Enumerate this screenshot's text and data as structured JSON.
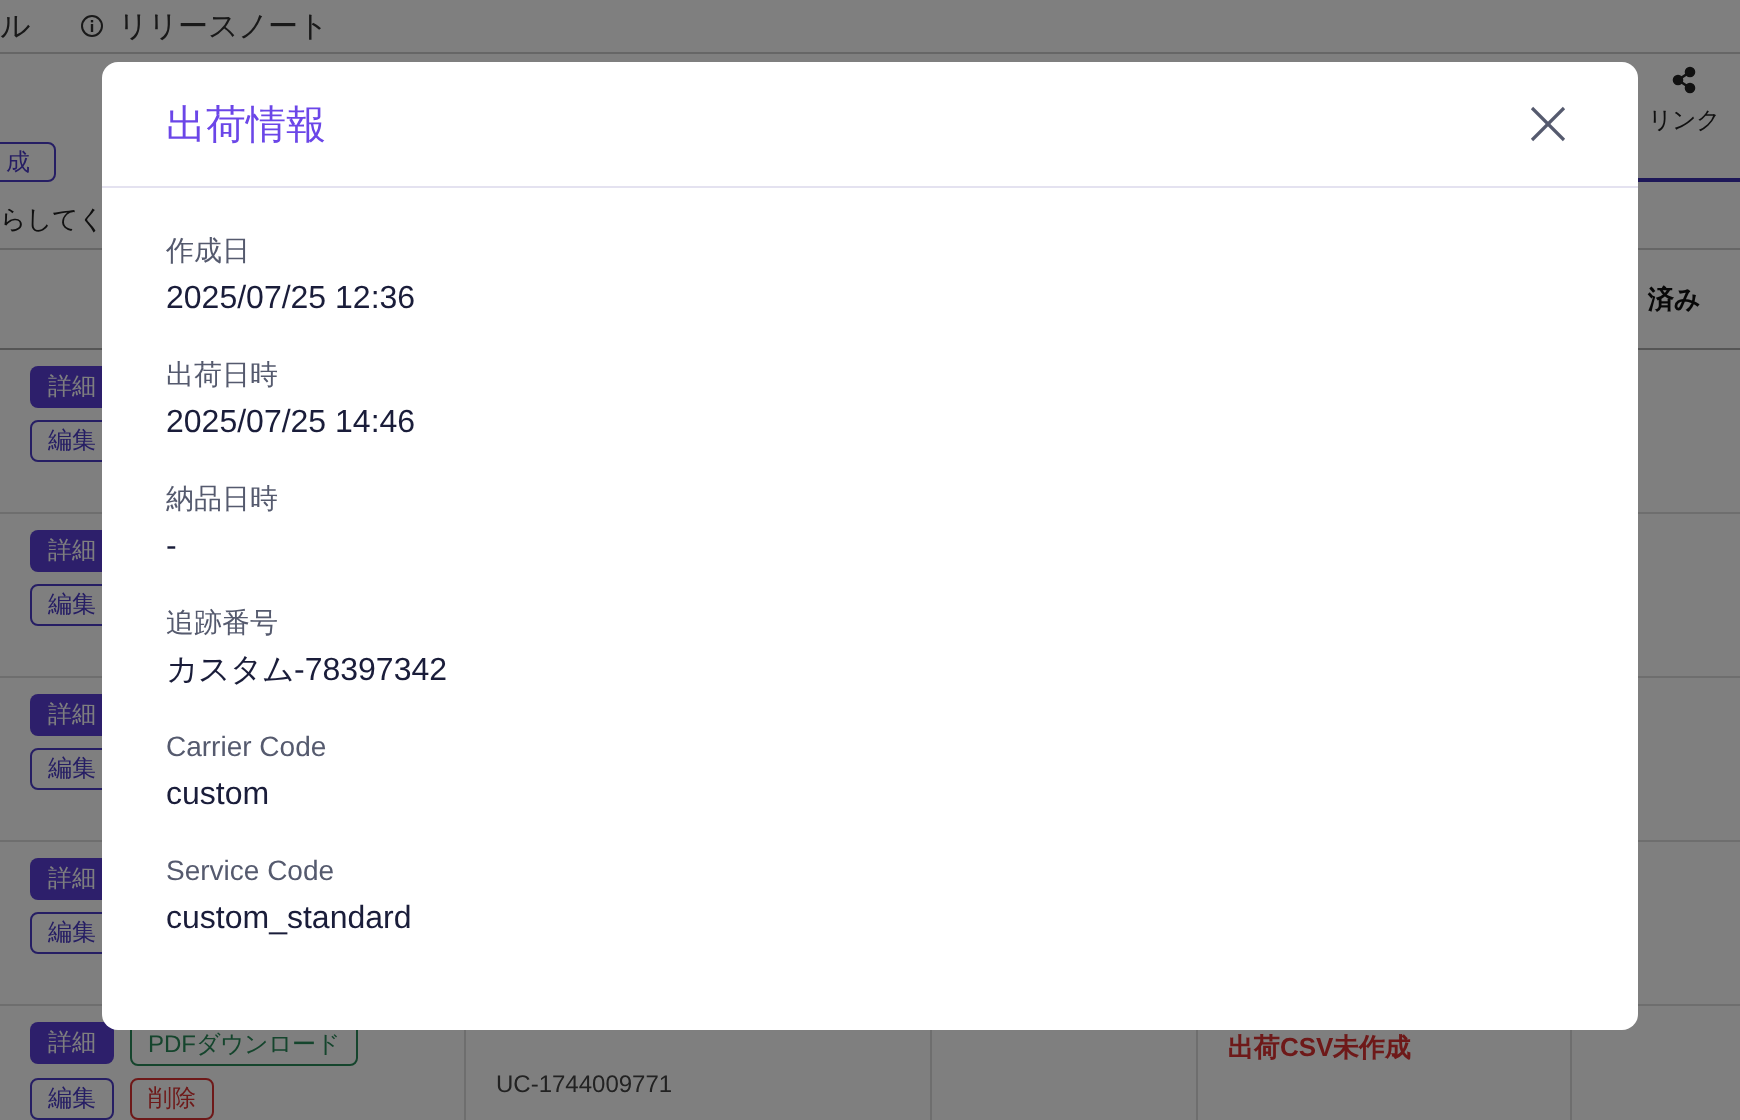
{
  "background": {
    "nav": {
      "cut_item": "ル",
      "release_notes": "リリースノート"
    },
    "toolbar": {
      "create_button": "成",
      "link": "リンク"
    },
    "notice": "らしてく",
    "header_status": "済み",
    "rows": [
      {
        "detail_button": "詳細",
        "edit_button": "編集"
      },
      {
        "detail_button": "詳細",
        "edit_button": "編集"
      },
      {
        "detail_button": "詳細",
        "edit_button": "編集"
      },
      {
        "detail_button": "詳細",
        "edit_button": "編集"
      },
      {
        "detail_button": "詳細",
        "edit_button": "編集",
        "pdf_button": "PDFダウンロード",
        "delete_button": "削除",
        "code": "UC-1744009771",
        "status": "出荷CSV未作成"
      }
    ]
  },
  "modal": {
    "title": "出荷情報",
    "fields": [
      {
        "label": "作成日",
        "value": "2025/07/25 12:36"
      },
      {
        "label": "出荷日時",
        "value": "2025/07/25 14:46"
      },
      {
        "label": "納品日時",
        "value": "-"
      },
      {
        "label": "追跡番号",
        "value": "カスタム-78397342"
      },
      {
        "label": "Carrier Code",
        "value": "custom"
      },
      {
        "label": "Service Code",
        "value": "custom_standard"
      }
    ]
  }
}
